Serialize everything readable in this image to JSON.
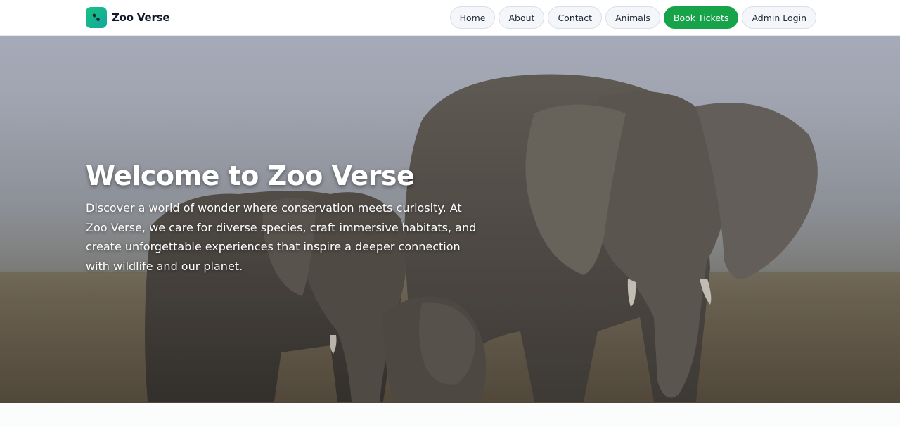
{
  "brand": {
    "name": "Zoo Verse",
    "logo_icon": "paw-icon",
    "logo_color": "#18c37e"
  },
  "nav": {
    "items": [
      {
        "label": "Home"
      },
      {
        "label": "About"
      },
      {
        "label": "Contact"
      },
      {
        "label": "Animals"
      },
      {
        "label": "Book Tickets"
      },
      {
        "label": "Admin Login"
      }
    ],
    "primary_color": "#16a34a"
  },
  "hero": {
    "title": "Welcome to Zoo Verse",
    "description": "Discover a world of wonder where conservation meets curiosity. At Zoo Verse, we care for diverse species, craft immersive habitats, and create unforgettable experiences that inspire a deeper connection with wildlife and our planet.",
    "background_image": "elephant-family-image"
  }
}
